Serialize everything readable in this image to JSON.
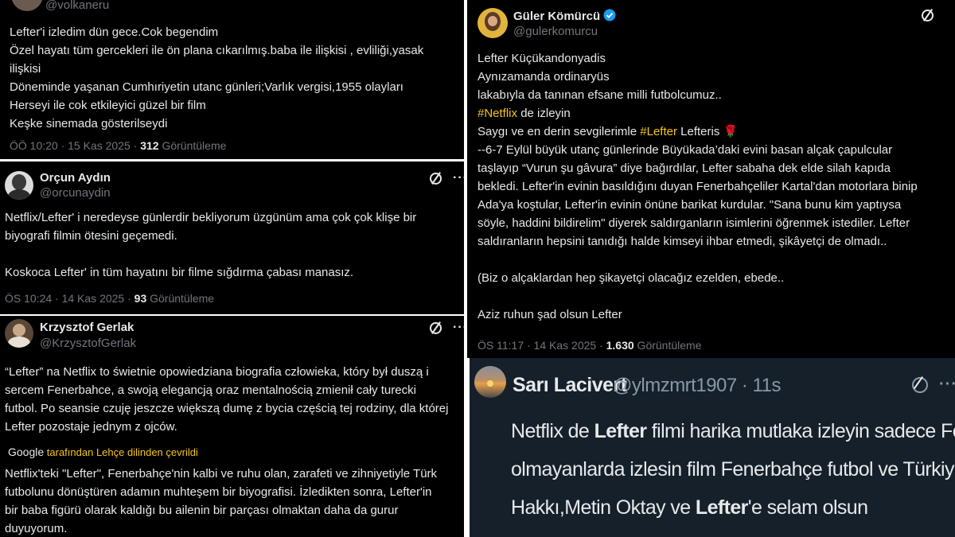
{
  "tweet1": {
    "handle": "@volkaneru",
    "lines": [
      "Lefter'i izledim dün gece.Cok begendim",
      "Özel hayatı tüm gercekleri ile  ön plana cıkarılmış.baba ile ilişkisi , evliliği,yasak",
      "ilişkisi",
      "Döneminde yaşanan Cumhıriyetin utanc günleri;Varlık vergisi,1955 olayları",
      "Herseyi ile cok etkileyici güzel bir film",
      "Keşke sinemada gösterilseydi"
    ],
    "time": "ÖÖ 10:20 · 15 Kas 2025 · ",
    "views": "312",
    "views_label": " Görüntüleme"
  },
  "tweet2": {
    "name": "Orçun Aydın",
    "handle": "@orcunaydin",
    "lines": [
      "Netflix/Lefter' i neredeyse günlerdir bekliyorum üzgünüm ama çok çok klişe bir",
      "biyografi filmin ötesini geçemedi.",
      "",
      "Koskoca Lefter' in tüm hayatını bir filme sığdırma çabası manasız."
    ],
    "time": "ÖS 10:24 · 14 Kas 2025 · ",
    "views": "93",
    "views_label": " Görüntüleme"
  },
  "tweet3": {
    "name": "Krzysztof Gerlak",
    "handle": "@KrzysztofGerlak",
    "lines": [
      "“Lefter” na Netflix to świetnie opowiedziana biografia człowieka, który był duszą i",
      "sercem Fenerbahce, a swoją elegancją oraz mentalnością zmienił cały turecki",
      "futbol. Po seansie czuję jeszcze większą dumę z bycia częścią tej rodziny, dla której",
      "Lefter pozostaje jednym z ojców."
    ],
    "google": "Google",
    "translated": "tarafından Lehçe dilinden çevrildi",
    "translation_lines": [
      "Netflix'teki \"Lefter\", Fenerbahçe'nin kalbi ve ruhu olan, zarafeti ve zihniyetiyle Türk",
      "futbolunu dönüştüren adamın muhteşem bir biyografisi. İzledikten sonra, Lefter'in",
      "bir baba figürü olarak kaldığı bu ailenin bir parçası olmaktan daha da gurur",
      "duyuyorum."
    ]
  },
  "tweet4": {
    "name": "Güler Kömürcü",
    "handle": "@gulerkomurcu",
    "l1": "Lefter Küçükandonyadis",
    "l2": "Aynızamanda ordinaryüs",
    "l3": " lakabıyla da tanınan efsane milli futbolcumuz..",
    "l4_tag": " #Netflix",
    "l4_rest": " de izleyin",
    "l5_pre": "Saygı ve en derin sevgilerimle ",
    "l5_tag": "#Lefter",
    "l5_post": " Lefteris 🌹",
    "l6": "--6-7 Eylül büyük utanç günlerinde Büyükada’daki evini basan alçak çapulcular",
    "l7": "taşlayıp “Vurun şu gâvura” diye bağırdılar, Lefter sabaha dek elde silah kapıda",
    "l8": "bekledi. Lefter'in evinin basıldığını duyan Fenerbahçeliler Kartal'dan motorlara binip",
    "l9": "Ada'ya koştular, Lefter'in evinin önüne barikat kurdular. \"Sana bunu kim yaptıysa",
    "l10": "söyle, haddini bildirelim\" diyerek saldırganların isimlerini öğrenmek istediler. Lefter",
    "l11": "saldıranların hepsini tanıdığı halde kimseyi ihbar etmedi, şikâyetçi de olmadı..",
    "l12": "(Biz o alçaklardan hep şikayetçi olacağız ezelden, ebede..",
    "l13": "Aziz ruhun şad olsun Lefter",
    "time": "ÖS 11:17 · 14 Kas 2025 · ",
    "views": "1.630",
    "views_label": " Görüntüleme"
  },
  "tweet5": {
    "name": "Sarı Lacivert",
    "handle": "@ylmzmrt1907 · 11s",
    "l1_a": "Netflix de ",
    "l1_b": "Lefter",
    "l1_c": " filmi harika mutlaka izleyin sadece Fenerbahçe li olanlar değil",
    "l2": "olmayanlarda izlesin film Fenerbahçe futbol ve Türkiye gerçeğini anlatiyor...Baba",
    "l3_a": "Hakkı,Metin Oktay ve ",
    "l3_b": "Lefter",
    "l3_c": "'e selam olsun"
  },
  "colors": {
    "background": "#000000",
    "text": "#e7e9ea",
    "muted": "#71767b",
    "hashtag": "#f5c518",
    "verified": "#1d9bf0",
    "dim_background": "#15202b"
  }
}
